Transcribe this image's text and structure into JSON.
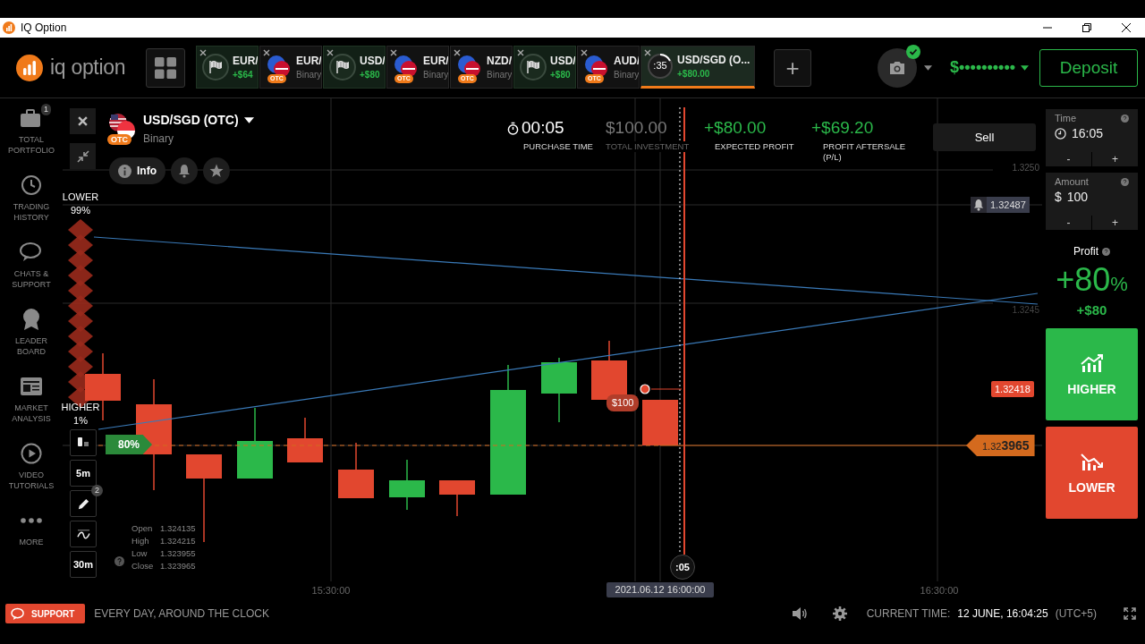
{
  "window": {
    "title": "IQ Option"
  },
  "logo": {
    "text": "iq option"
  },
  "asset_tabs": [
    {
      "kind": "flag",
      "pair": "EUR/",
      "sub": "+$64",
      "selected": false
    },
    {
      "kind": "otc",
      "pair": "EUR/",
      "sub": "Binary",
      "badge": "OTC",
      "selected": false
    },
    {
      "kind": "flag",
      "pair": "USD/",
      "sub": "+$80",
      "selected": false
    },
    {
      "kind": "otc",
      "pair": "EUR/",
      "sub": "Binary",
      "badge": "OTC",
      "selected": false
    },
    {
      "kind": "otc",
      "pair": "NZD/",
      "sub": "Binary",
      "badge": "OTC",
      "selected": false
    },
    {
      "kind": "flag",
      "pair": "USD/",
      "sub": "+$80",
      "selected": false
    },
    {
      "kind": "otc",
      "pair": "AUD/",
      "sub": "Binary",
      "badge": "OTC",
      "selected": false
    },
    {
      "kind": "timer",
      "timer": ":35",
      "pair": "USD/SGD (O...",
      "sub": "+$80.00",
      "selected": true
    }
  ],
  "add_tab": "+",
  "balance": "$••••••••••",
  "deposit": "Deposit",
  "sidebar": [
    {
      "kind": "portfolio",
      "label": "TOTAL PORTFOLIO",
      "badge": "1"
    },
    {
      "kind": "history",
      "label": "TRADING HISTORY"
    },
    {
      "kind": "chat",
      "label": "CHATS & SUPPORT"
    },
    {
      "kind": "leader",
      "label": "LEADER BOARD"
    },
    {
      "kind": "analysis",
      "label": "MARKET ANALYSIS"
    },
    {
      "kind": "video",
      "label": "VIDEO TUTORIALS"
    },
    {
      "kind": "more",
      "label": "MORE"
    }
  ],
  "asset": {
    "name": "USD/SGD (OTC)",
    "type": "Binary",
    "badge": "OTC",
    "info": "Info"
  },
  "stats": [
    {
      "kind": "timer",
      "value": "00:05",
      "label": "PURCHASE TIME"
    },
    {
      "kind": "muted",
      "value": "$100.00",
      "label": "TOTAL INVESTMENT"
    },
    {
      "kind": "profit",
      "value": "+$80.00",
      "label": "EXPECTED PROFIT"
    },
    {
      "kind": "profit",
      "value": "+$69.20",
      "label": "PROFIT AFTERSALE (P/L)"
    }
  ],
  "sell": "Sell",
  "chart": {
    "sentiment_lower": {
      "label": "LOWER",
      "value": "99%"
    },
    "sentiment_higher": {
      "label": "HIGHER",
      "value": "1%"
    },
    "payout": "80%",
    "price_labels": [
      "1.3250",
      "1.3245"
    ],
    "alert_price": "1.32487",
    "strike_price": "1.32418",
    "current_price": {
      "prefix": "1.32",
      "main": "3965"
    },
    "deal_amount": "$100",
    "countdown": ":05",
    "time_labels": [
      "15:30:00",
      "2021.06.12 16:00:00",
      "16:30:00"
    ],
    "tools": [
      {
        "kind": "candles"
      },
      {
        "kind": "text",
        "label": "5m"
      },
      {
        "kind": "pencil",
        "badge": "2"
      },
      {
        "kind": "wave"
      },
      {
        "kind": "text",
        "label": "30m"
      }
    ],
    "ohlc": [
      {
        "label": "Open",
        "value": "1.324135"
      },
      {
        "label": "High",
        "value": "1.324215"
      },
      {
        "label": "Low",
        "value": "1.323955"
      },
      {
        "label": "Close",
        "value": "1.323965"
      }
    ]
  },
  "trade": {
    "time": {
      "label": "Time",
      "value": "16:05",
      "minus": "-",
      "plus": "+"
    },
    "amount": {
      "label": "Amount",
      "currency": "$",
      "value": "100",
      "minus": "-",
      "plus": "+"
    },
    "profit": {
      "label": "Profit",
      "percent": "+80",
      "unit": "%",
      "amount": "+$80"
    },
    "higher": "HIGHER",
    "lower": "LOWER"
  },
  "footer": {
    "support": "SUPPORT",
    "tagline": "EVERY DAY, AROUND THE CLOCK",
    "time_label": "CURRENT TIME:",
    "time_value": "12 JUNE, 16:04:25",
    "timezone": "(UTC+5)"
  }
}
